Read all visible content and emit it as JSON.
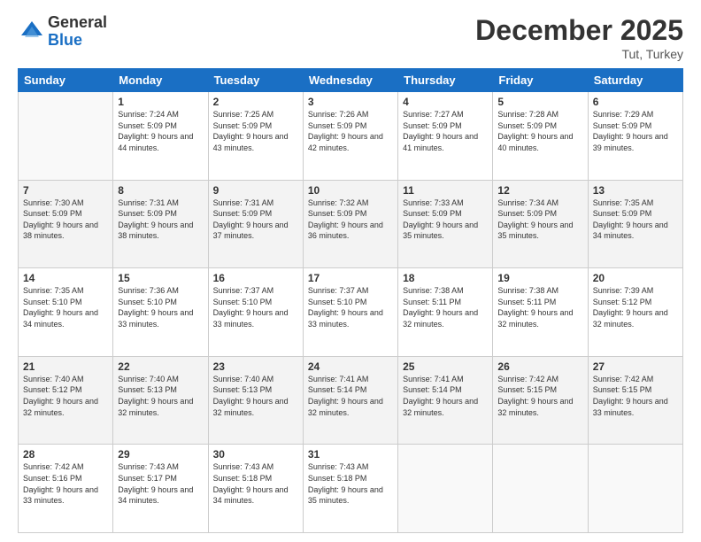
{
  "header": {
    "logo_general": "General",
    "logo_blue": "Blue",
    "month_title": "December 2025",
    "subtitle": "Tut, Turkey"
  },
  "weekdays": [
    "Sunday",
    "Monday",
    "Tuesday",
    "Wednesday",
    "Thursday",
    "Friday",
    "Saturday"
  ],
  "weeks": [
    [
      {
        "day": "",
        "sunrise": "",
        "sunset": "",
        "daylight": ""
      },
      {
        "day": "1",
        "sunrise": "Sunrise: 7:24 AM",
        "sunset": "Sunset: 5:09 PM",
        "daylight": "Daylight: 9 hours and 44 minutes."
      },
      {
        "day": "2",
        "sunrise": "Sunrise: 7:25 AM",
        "sunset": "Sunset: 5:09 PM",
        "daylight": "Daylight: 9 hours and 43 minutes."
      },
      {
        "day": "3",
        "sunrise": "Sunrise: 7:26 AM",
        "sunset": "Sunset: 5:09 PM",
        "daylight": "Daylight: 9 hours and 42 minutes."
      },
      {
        "day": "4",
        "sunrise": "Sunrise: 7:27 AM",
        "sunset": "Sunset: 5:09 PM",
        "daylight": "Daylight: 9 hours and 41 minutes."
      },
      {
        "day": "5",
        "sunrise": "Sunrise: 7:28 AM",
        "sunset": "Sunset: 5:09 PM",
        "daylight": "Daylight: 9 hours and 40 minutes."
      },
      {
        "day": "6",
        "sunrise": "Sunrise: 7:29 AM",
        "sunset": "Sunset: 5:09 PM",
        "daylight": "Daylight: 9 hours and 39 minutes."
      }
    ],
    [
      {
        "day": "7",
        "sunrise": "Sunrise: 7:30 AM",
        "sunset": "Sunset: 5:09 PM",
        "daylight": "Daylight: 9 hours and 38 minutes."
      },
      {
        "day": "8",
        "sunrise": "Sunrise: 7:31 AM",
        "sunset": "Sunset: 5:09 PM",
        "daylight": "Daylight: 9 hours and 38 minutes."
      },
      {
        "day": "9",
        "sunrise": "Sunrise: 7:31 AM",
        "sunset": "Sunset: 5:09 PM",
        "daylight": "Daylight: 9 hours and 37 minutes."
      },
      {
        "day": "10",
        "sunrise": "Sunrise: 7:32 AM",
        "sunset": "Sunset: 5:09 PM",
        "daylight": "Daylight: 9 hours and 36 minutes."
      },
      {
        "day": "11",
        "sunrise": "Sunrise: 7:33 AM",
        "sunset": "Sunset: 5:09 PM",
        "daylight": "Daylight: 9 hours and 35 minutes."
      },
      {
        "day": "12",
        "sunrise": "Sunrise: 7:34 AM",
        "sunset": "Sunset: 5:09 PM",
        "daylight": "Daylight: 9 hours and 35 minutes."
      },
      {
        "day": "13",
        "sunrise": "Sunrise: 7:35 AM",
        "sunset": "Sunset: 5:09 PM",
        "daylight": "Daylight: 9 hours and 34 minutes."
      }
    ],
    [
      {
        "day": "14",
        "sunrise": "Sunrise: 7:35 AM",
        "sunset": "Sunset: 5:10 PM",
        "daylight": "Daylight: 9 hours and 34 minutes."
      },
      {
        "day": "15",
        "sunrise": "Sunrise: 7:36 AM",
        "sunset": "Sunset: 5:10 PM",
        "daylight": "Daylight: 9 hours and 33 minutes."
      },
      {
        "day": "16",
        "sunrise": "Sunrise: 7:37 AM",
        "sunset": "Sunset: 5:10 PM",
        "daylight": "Daylight: 9 hours and 33 minutes."
      },
      {
        "day": "17",
        "sunrise": "Sunrise: 7:37 AM",
        "sunset": "Sunset: 5:10 PM",
        "daylight": "Daylight: 9 hours and 33 minutes."
      },
      {
        "day": "18",
        "sunrise": "Sunrise: 7:38 AM",
        "sunset": "Sunset: 5:11 PM",
        "daylight": "Daylight: 9 hours and 32 minutes."
      },
      {
        "day": "19",
        "sunrise": "Sunrise: 7:38 AM",
        "sunset": "Sunset: 5:11 PM",
        "daylight": "Daylight: 9 hours and 32 minutes."
      },
      {
        "day": "20",
        "sunrise": "Sunrise: 7:39 AM",
        "sunset": "Sunset: 5:12 PM",
        "daylight": "Daylight: 9 hours and 32 minutes."
      }
    ],
    [
      {
        "day": "21",
        "sunrise": "Sunrise: 7:40 AM",
        "sunset": "Sunset: 5:12 PM",
        "daylight": "Daylight: 9 hours and 32 minutes."
      },
      {
        "day": "22",
        "sunrise": "Sunrise: 7:40 AM",
        "sunset": "Sunset: 5:13 PM",
        "daylight": "Daylight: 9 hours and 32 minutes."
      },
      {
        "day": "23",
        "sunrise": "Sunrise: 7:40 AM",
        "sunset": "Sunset: 5:13 PM",
        "daylight": "Daylight: 9 hours and 32 minutes."
      },
      {
        "day": "24",
        "sunrise": "Sunrise: 7:41 AM",
        "sunset": "Sunset: 5:14 PM",
        "daylight": "Daylight: 9 hours and 32 minutes."
      },
      {
        "day": "25",
        "sunrise": "Sunrise: 7:41 AM",
        "sunset": "Sunset: 5:14 PM",
        "daylight": "Daylight: 9 hours and 32 minutes."
      },
      {
        "day": "26",
        "sunrise": "Sunrise: 7:42 AM",
        "sunset": "Sunset: 5:15 PM",
        "daylight": "Daylight: 9 hours and 32 minutes."
      },
      {
        "day": "27",
        "sunrise": "Sunrise: 7:42 AM",
        "sunset": "Sunset: 5:15 PM",
        "daylight": "Daylight: 9 hours and 33 minutes."
      }
    ],
    [
      {
        "day": "28",
        "sunrise": "Sunrise: 7:42 AM",
        "sunset": "Sunset: 5:16 PM",
        "daylight": "Daylight: 9 hours and 33 minutes."
      },
      {
        "day": "29",
        "sunrise": "Sunrise: 7:43 AM",
        "sunset": "Sunset: 5:17 PM",
        "daylight": "Daylight: 9 hours and 34 minutes."
      },
      {
        "day": "30",
        "sunrise": "Sunrise: 7:43 AM",
        "sunset": "Sunset: 5:18 PM",
        "daylight": "Daylight: 9 hours and 34 minutes."
      },
      {
        "day": "31",
        "sunrise": "Sunrise: 7:43 AM",
        "sunset": "Sunset: 5:18 PM",
        "daylight": "Daylight: 9 hours and 35 minutes."
      },
      {
        "day": "",
        "sunrise": "",
        "sunset": "",
        "daylight": ""
      },
      {
        "day": "",
        "sunrise": "",
        "sunset": "",
        "daylight": ""
      },
      {
        "day": "",
        "sunrise": "",
        "sunset": "",
        "daylight": ""
      }
    ]
  ]
}
